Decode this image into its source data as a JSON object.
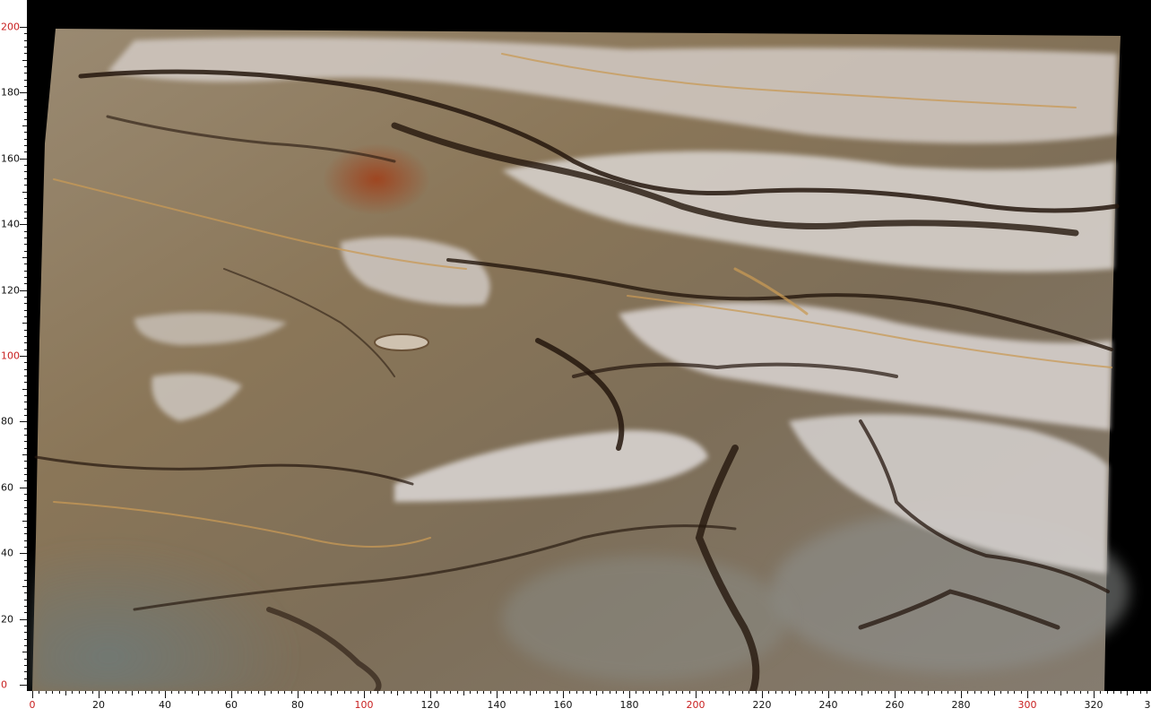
{
  "image": {
    "subject": "polished stone slab photograph with measurement rulers",
    "background_color": "#000000",
    "slab_colors": {
      "base": "#8c7a60",
      "light_vein": "#d8d2cc",
      "dark_vein": "#2a1a10",
      "rust": "#9a4a20",
      "gold": "#c8a060",
      "grey_blue": "#7a8484"
    }
  },
  "ruler_left": {
    "labels": [
      "0",
      "20",
      "40",
      "60",
      "80",
      "100",
      "120",
      "140",
      "160",
      "180",
      "200"
    ],
    "highlight": [
      "0",
      "100",
      "200"
    ]
  },
  "ruler_bottom": {
    "labels": [
      "0",
      "20",
      "40",
      "60",
      "80",
      "100",
      "120",
      "140",
      "160",
      "180",
      "200",
      "220",
      "240",
      "260",
      "280",
      "300",
      "320",
      "3"
    ],
    "highlight": [
      "0",
      "100",
      "200",
      "300"
    ]
  }
}
